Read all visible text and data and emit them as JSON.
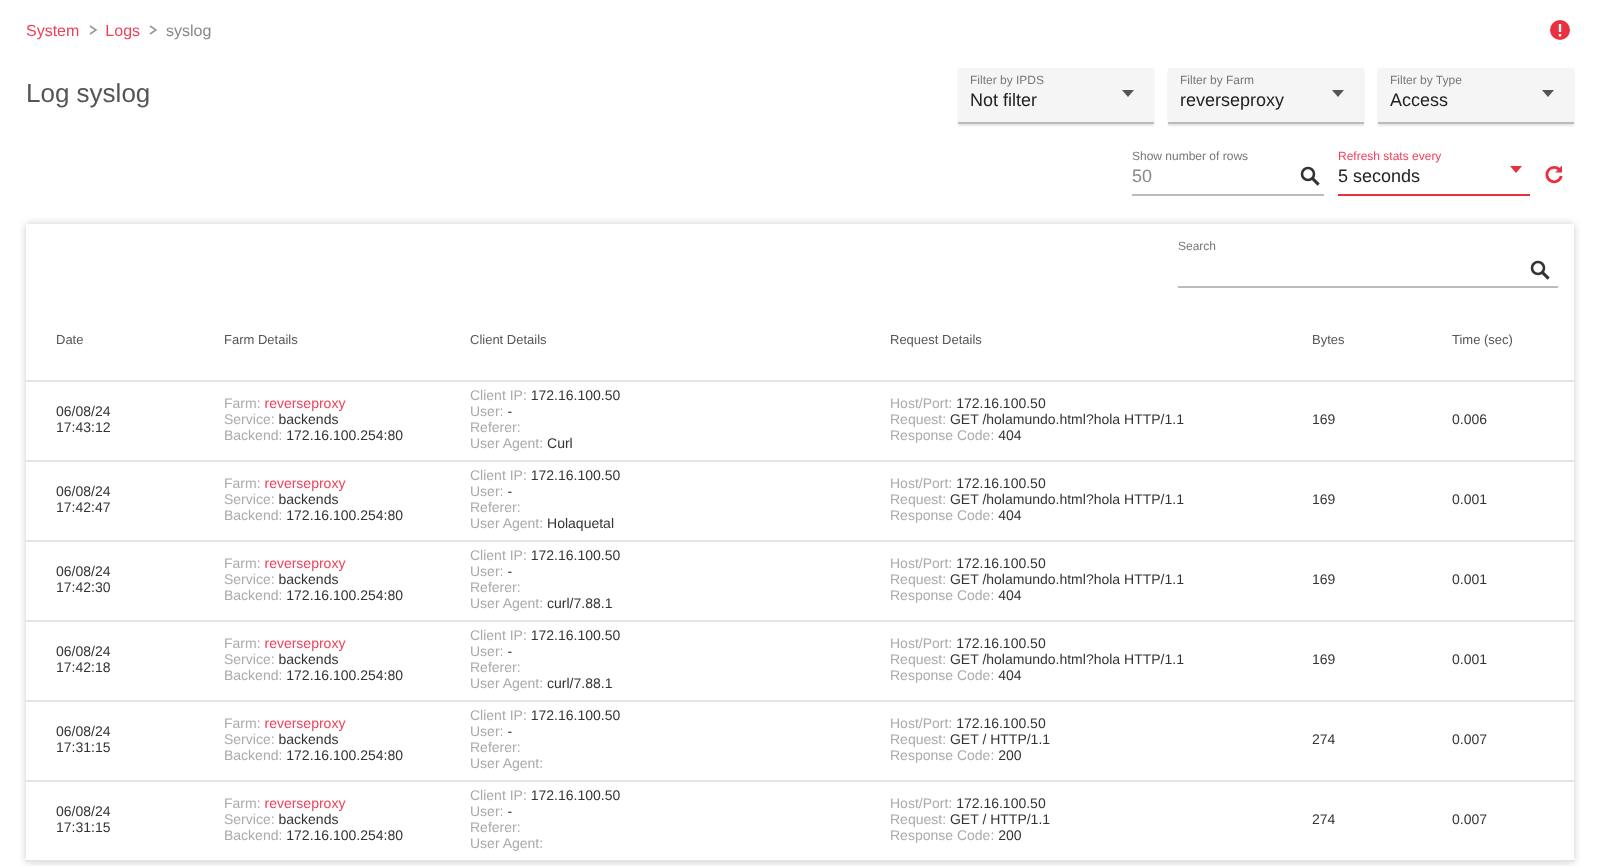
{
  "breadcrumb": [
    {
      "label": "System",
      "link": true
    },
    {
      "label": "Logs",
      "link": true
    },
    {
      "label": "syslog",
      "link": false
    }
  ],
  "title": "Log syslog",
  "filters": [
    {
      "label": "Filter by IPDS",
      "value": "Not filter"
    },
    {
      "label": "Filter by Farm",
      "value": "reverseproxy"
    },
    {
      "label": "Filter by Type",
      "value": "Access"
    }
  ],
  "rows_field": {
    "label": "Show number of rows",
    "placeholder": "50"
  },
  "refresh_field": {
    "label": "Refresh stats every",
    "value": "5 seconds"
  },
  "search": {
    "label": "Search"
  },
  "table": {
    "columns": [
      "Date",
      "Farm Details",
      "Client Details",
      "Request Details",
      "Bytes",
      "Time (sec)"
    ],
    "rows": [
      {
        "date": [
          "06/08/24",
          "17:43:12"
        ],
        "farm": [
          [
            "Farm:",
            "reverseproxy"
          ],
          [
            "Service:",
            "backends"
          ],
          [
            "Backend:",
            "172.16.100.254:80"
          ]
        ],
        "client": [
          [
            "Client IP:",
            "172.16.100.50"
          ],
          [
            "User:",
            "-"
          ],
          [
            "Referer:"
          ],
          [
            "User Agent:",
            "Curl"
          ]
        ],
        "request": [
          [
            "Host/Port:",
            "172.16.100.50"
          ],
          [
            "Request:",
            "GET /holamundo.html?hola HTTP/1.1"
          ],
          [
            "Response Code:",
            "404"
          ]
        ],
        "bytes": "169",
        "time": "0.006"
      },
      {
        "date": [
          "06/08/24",
          "17:42:47"
        ],
        "farm": [
          [
            "Farm:",
            "reverseproxy"
          ],
          [
            "Service:",
            "backends"
          ],
          [
            "Backend:",
            "172.16.100.254:80"
          ]
        ],
        "client": [
          [
            "Client IP:",
            "172.16.100.50"
          ],
          [
            "User:",
            "-"
          ],
          [
            "Referer:"
          ],
          [
            "User Agent:",
            "Holaquetal"
          ]
        ],
        "request": [
          [
            "Host/Port:",
            "172.16.100.50"
          ],
          [
            "Request:",
            "GET /holamundo.html?hola HTTP/1.1"
          ],
          [
            "Response Code:",
            "404"
          ]
        ],
        "bytes": "169",
        "time": "0.001"
      },
      {
        "date": [
          "06/08/24",
          "17:42:30"
        ],
        "farm": [
          [
            "Farm:",
            "reverseproxy"
          ],
          [
            "Service:",
            "backends"
          ],
          [
            "Backend:",
            "172.16.100.254:80"
          ]
        ],
        "client": [
          [
            "Client IP:",
            "172.16.100.50"
          ],
          [
            "User:",
            "-"
          ],
          [
            "Referer:"
          ],
          [
            "User Agent:",
            "curl/7.88.1"
          ]
        ],
        "request": [
          [
            "Host/Port:",
            "172.16.100.50"
          ],
          [
            "Request:",
            "GET /holamundo.html?hola HTTP/1.1"
          ],
          [
            "Response Code:",
            "404"
          ]
        ],
        "bytes": "169",
        "time": "0.001"
      },
      {
        "date": [
          "06/08/24",
          "17:42:18"
        ],
        "farm": [
          [
            "Farm:",
            "reverseproxy"
          ],
          [
            "Service:",
            "backends"
          ],
          [
            "Backend:",
            "172.16.100.254:80"
          ]
        ],
        "client": [
          [
            "Client IP:",
            "172.16.100.50"
          ],
          [
            "User:",
            "-"
          ],
          [
            "Referer:"
          ],
          [
            "User Agent:",
            "curl/7.88.1"
          ]
        ],
        "request": [
          [
            "Host/Port:",
            "172.16.100.50"
          ],
          [
            "Request:",
            "GET /holamundo.html?hola HTTP/1.1"
          ],
          [
            "Response Code:",
            "404"
          ]
        ],
        "bytes": "169",
        "time": "0.001"
      },
      {
        "date": [
          "06/08/24",
          "17:31:15"
        ],
        "farm": [
          [
            "Farm:",
            "reverseproxy"
          ],
          [
            "Service:",
            "backends"
          ],
          [
            "Backend:",
            "172.16.100.254:80"
          ]
        ],
        "client": [
          [
            "Client IP:",
            "172.16.100.50"
          ],
          [
            "User:",
            "-"
          ],
          [
            "Referer:"
          ],
          [
            "User Agent:"
          ]
        ],
        "request": [
          [
            "Host/Port:",
            "172.16.100.50"
          ],
          [
            "Request:",
            "GET / HTTP/1.1"
          ],
          [
            "Response Code:",
            "200"
          ]
        ],
        "bytes": "274",
        "time": "0.007"
      },
      {
        "date": [
          "06/08/24",
          "17:31:15"
        ],
        "farm": [
          [
            "Farm:",
            "reverseproxy"
          ],
          [
            "Service:",
            "backends"
          ],
          [
            "Backend:",
            "172.16.100.254:80"
          ]
        ],
        "client": [
          [
            "Client IP:",
            "172.16.100.50"
          ],
          [
            "User:",
            "-"
          ],
          [
            "Referer:"
          ],
          [
            "User Agent:"
          ]
        ],
        "request": [
          [
            "Host/Port:",
            "172.16.100.50"
          ],
          [
            "Request:",
            "GET / HTTP/1.1"
          ],
          [
            "Response Code:",
            "200"
          ]
        ],
        "bytes": "274",
        "time": "0.007"
      }
    ]
  }
}
